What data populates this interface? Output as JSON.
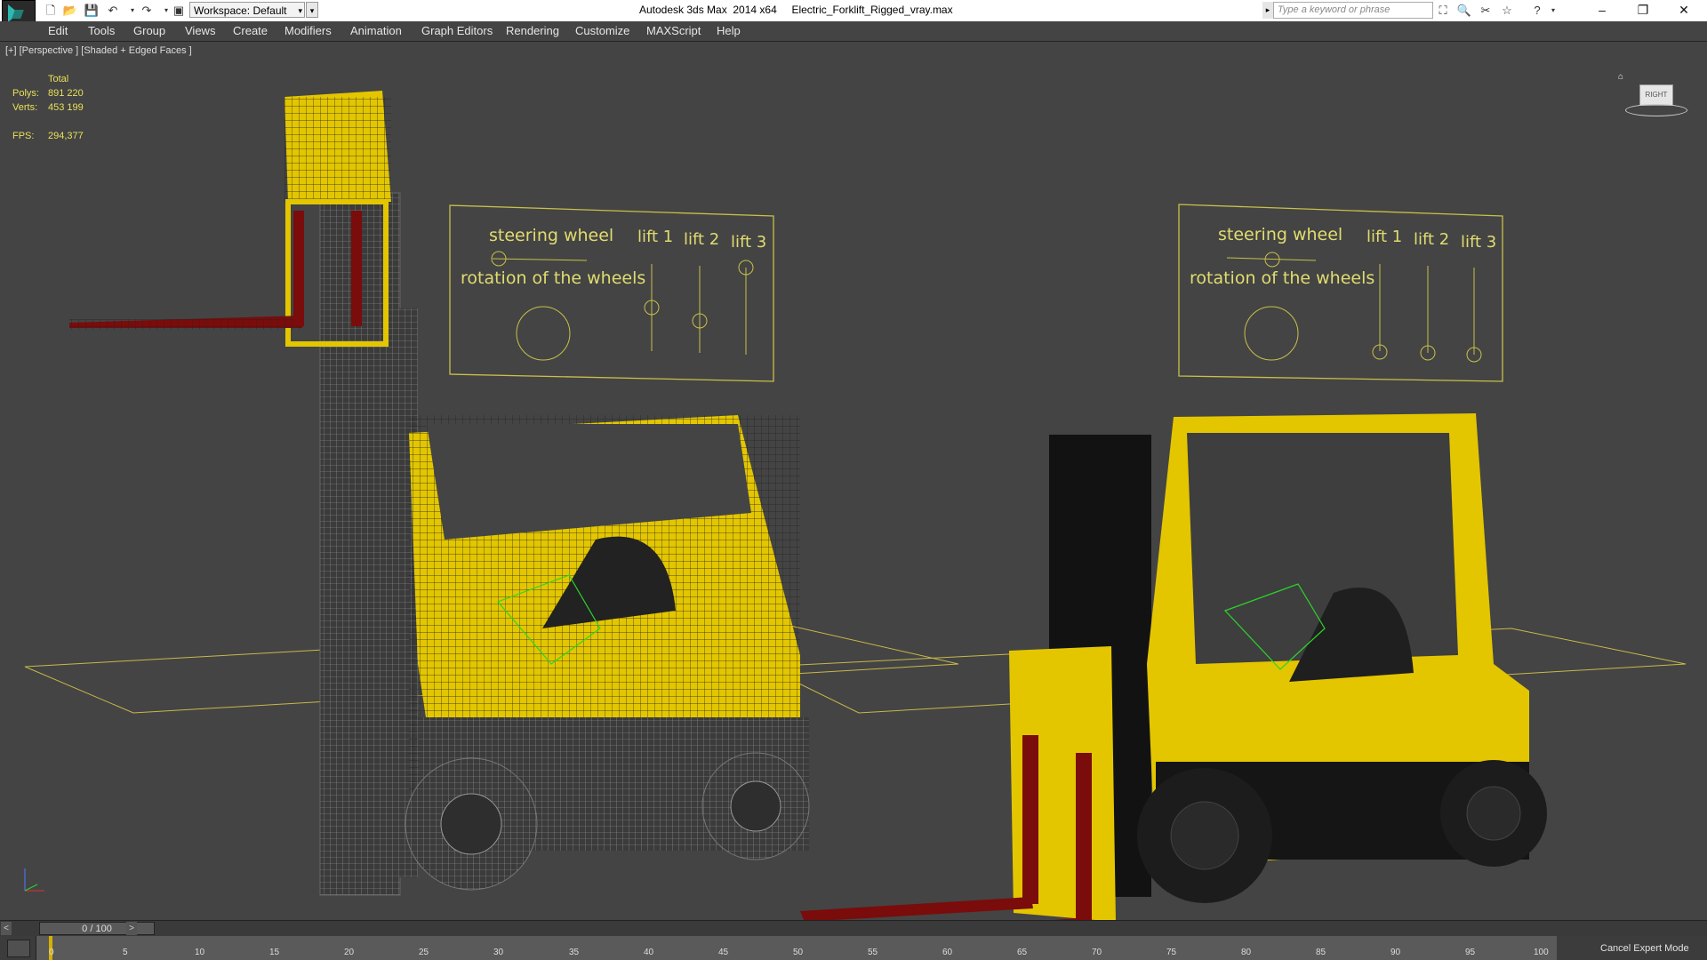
{
  "app": {
    "title": "Autodesk 3ds Max  2014 x64",
    "file": "Electric_Forklift_Rigged_vray.max"
  },
  "workspace": {
    "label": "Workspace: Default"
  },
  "search": {
    "placeholder": "Type a keyword or phrase"
  },
  "menu": [
    "Edit",
    "Tools",
    "Group",
    "Views",
    "Create",
    "Modifiers",
    "Animation",
    "Graph Editors",
    "Rendering",
    "Customize",
    "MAXScript",
    "Help"
  ],
  "viewport": {
    "label": "[+] [Perspective ] [Shaded + Edged Faces ]",
    "stats": {
      "header": "Total",
      "polys_label": "Polys:",
      "polys": "891 220",
      "verts_label": "Verts:",
      "verts": "453 199",
      "fps_label": "FPS:",
      "fps": "294,377"
    },
    "viewcube_label": "RIGHT"
  },
  "rig_panels": [
    {
      "steering": "steering wheel",
      "rotation": "rotation of the wheels",
      "lifts": [
        "lift 1",
        "lift 2",
        "lift 3"
      ]
    },
    {
      "steering": "steering wheel",
      "rotation": "rotation of the wheels",
      "lifts": [
        "lift 1",
        "lift 2",
        "lift 3"
      ]
    }
  ],
  "timeline": {
    "position": "0 / 100",
    "ticks": [
      "0",
      "5",
      "10",
      "15",
      "20",
      "25",
      "30",
      "35",
      "40",
      "45",
      "50",
      "55",
      "60",
      "65",
      "70",
      "75",
      "80",
      "85",
      "90",
      "95",
      "100"
    ]
  },
  "status": {
    "expert_mode": "Cancel Expert Mode"
  },
  "colors": {
    "viewport_bg": "#444444",
    "forklift_yellow": "#e3c600",
    "fork_red": "#7a0c0c",
    "wire_yellow": "#e8e05a",
    "helper_green": "#2bd52b"
  }
}
